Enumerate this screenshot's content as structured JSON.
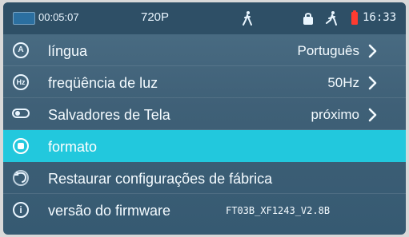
{
  "status": {
    "recording_time": "00:05:07",
    "resolution": "720P",
    "time": "16:33",
    "icons": [
      "record-icon",
      "person-walk-icon",
      "lock-icon",
      "person-run-icon",
      "battery-icon"
    ]
  },
  "menu": {
    "items": [
      {
        "label": "língua",
        "value": "Português",
        "icon": "a-circle-icon",
        "has_chevron": true,
        "selected": false
      },
      {
        "label": "freqüência de luz",
        "value": "50Hz",
        "icon": "hz-circle-icon",
        "has_chevron": true,
        "selected": false
      },
      {
        "label": "Salvadores de Tela",
        "value": "próximo",
        "icon": "toggle-icon",
        "has_chevron": true,
        "selected": false
      },
      {
        "label": "formato",
        "value": "",
        "icon": "sd-card-icon",
        "has_chevron": false,
        "selected": true
      },
      {
        "label": "Restaurar configurações de fábrica",
        "value": "",
        "icon": "restore-icon",
        "has_chevron": false,
        "selected": false
      },
      {
        "label": "versão do firmware",
        "value": "FT03B_XF1243_V2.8B",
        "icon": "info-icon",
        "has_chevron": false,
        "selected": false
      }
    ]
  },
  "colors": {
    "background": "#3f6077",
    "status_bar": "#2e4f66",
    "selected_row": "#22c8dd",
    "text": "#f4fbff"
  }
}
